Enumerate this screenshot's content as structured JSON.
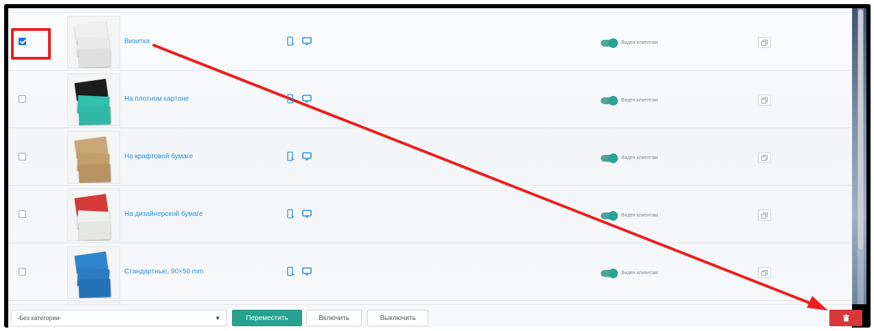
{
  "colors": {
    "link": "#2a93d5",
    "toggle_on": "#2aa294",
    "move_button": "#27a28f",
    "delete_button": "#d9383a",
    "annotation": "#ee1c1c"
  },
  "rows": [
    {
      "name": "Визитка",
      "checked": true,
      "visible_label": "Виден клиентам",
      "thumb": [
        "#efefef",
        "#e9e9e9",
        "#dedede"
      ]
    },
    {
      "name": "На плотном картоне",
      "checked": false,
      "visible_label": "Виден клиентам",
      "thumb": [
        "#1d1d1d",
        "#30c0ac",
        "#2fb8a5"
      ]
    },
    {
      "name": "На крафтовой бумаге",
      "checked": false,
      "visible_label": "Виден клиентам",
      "thumb": [
        "#c9a774",
        "#c29e6b",
        "#b89362"
      ]
    },
    {
      "name": "На дизайнерской бумаге",
      "checked": false,
      "visible_label": "Виден клиентам",
      "thumb": [
        "#d43a3a",
        "#eef0ee",
        "#e3e6e3"
      ]
    },
    {
      "name": "Стандартные, 90×50 mm",
      "checked": false,
      "visible_label": "Виден клиентам",
      "thumb": [
        "#2f86cf",
        "#2b7cc2",
        "#2672b6"
      ]
    }
  ],
  "row_icons": [
    "mobile-icon",
    "desktop-icon"
  ],
  "bottom_bar": {
    "category_select": "-Без категории-",
    "move_button": "Переместить",
    "enable_button": "Включить",
    "disable_button": "Выключить",
    "delete_icon": "trash-icon"
  }
}
